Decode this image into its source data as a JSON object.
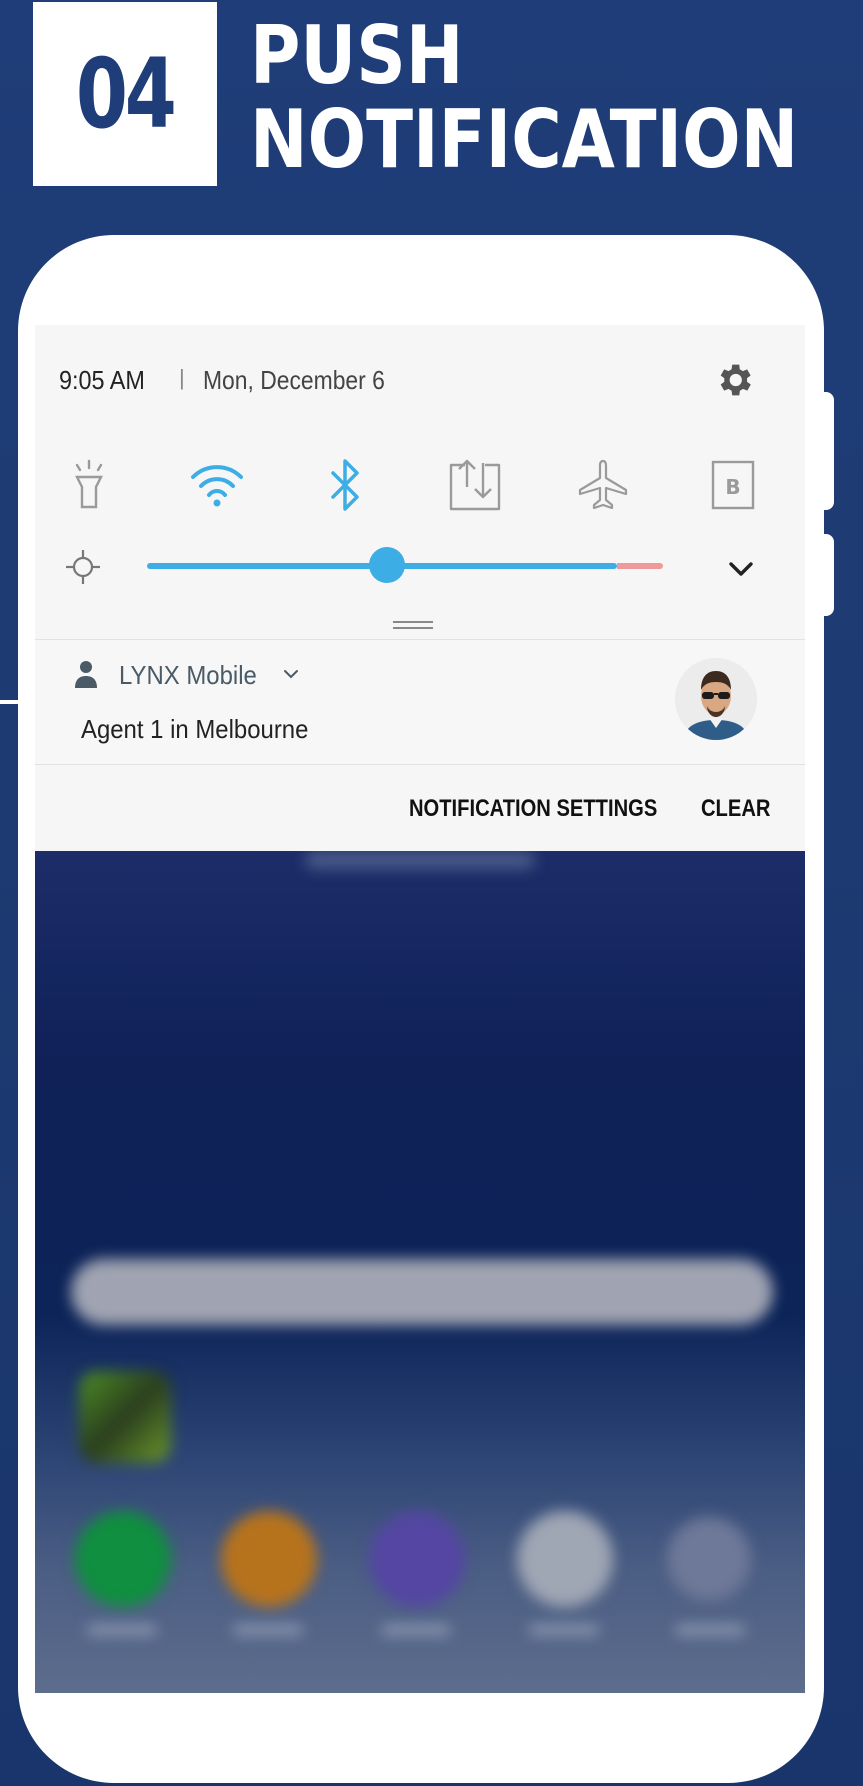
{
  "header": {
    "step_number": "04",
    "title_line1": "PUSH",
    "title_line2": "NOTIFICATION"
  },
  "status_bar": {
    "time": "9:05 AM",
    "separator": "|",
    "date": "Mon, December 6",
    "settings_icon": "gear-icon"
  },
  "quick_settings": {
    "tiles": [
      {
        "icon": "flashlight-icon",
        "active": false
      },
      {
        "icon": "wifi-icon",
        "active": true
      },
      {
        "icon": "bluetooth-icon",
        "active": true
      },
      {
        "icon": "data-sync-icon",
        "active": false
      },
      {
        "icon": "airplane-mode-icon",
        "active": false
      },
      {
        "icon": "blue-light-filter-icon",
        "label": "B",
        "active": false
      }
    ],
    "brightness_level": 0.51,
    "accent_color": "#3daee5",
    "warning_color": "#ef9a9a"
  },
  "notification": {
    "app_name": "LYNX Mobile",
    "message": "Agent 1 in Melbourne",
    "avatar_icon": "avatar"
  },
  "actions": {
    "settings_label": "NOTIFICATION SETTINGS",
    "clear_label": "CLEAR"
  },
  "colors": {
    "background": "#1f3d78",
    "badge_text": "#1f3d78"
  }
}
